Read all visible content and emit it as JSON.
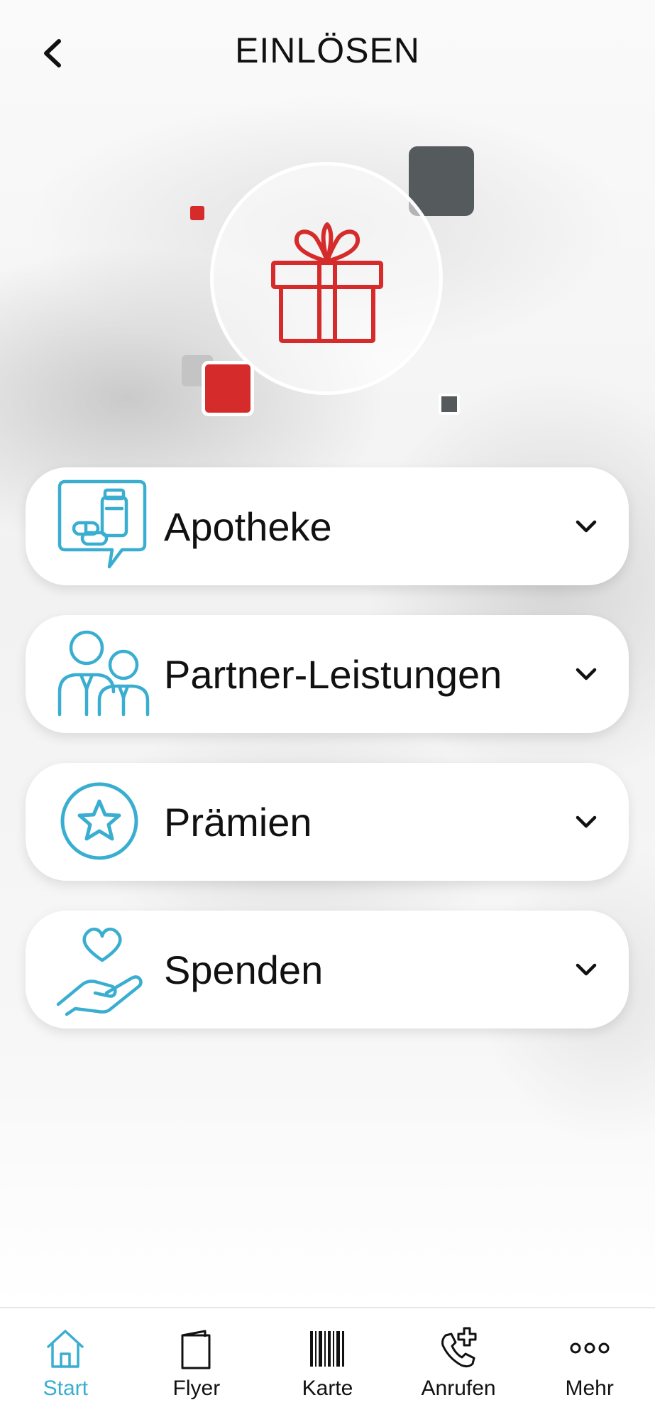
{
  "header": {
    "title": "EINLÖSEN",
    "back_icon": "chevron-left-icon"
  },
  "hero": {
    "icon": "gift-icon",
    "accent_color": "#d62b2b",
    "secondary_color": "#555a5c"
  },
  "categories": [
    {
      "label": "Apotheke",
      "icon": "pharmacy-icon"
    },
    {
      "label": "Partner-Leistungen",
      "icon": "partners-icon"
    },
    {
      "label": "Prämien",
      "icon": "star-icon"
    },
    {
      "label": "Spenden",
      "icon": "heart-hand-icon"
    }
  ],
  "bottom_nav": {
    "active": "Start",
    "items": [
      {
        "label": "Start",
        "icon": "home-icon"
      },
      {
        "label": "Flyer",
        "icon": "flyer-icon"
      },
      {
        "label": "Karte",
        "icon": "barcode-icon"
      },
      {
        "label": "Anrufen",
        "icon": "phone-plus-icon"
      },
      {
        "label": "Mehr",
        "icon": "more-icon"
      }
    ]
  },
  "colors": {
    "accent_blue": "#3aaed0",
    "accent_red": "#d62b2b",
    "text": "#111111"
  }
}
